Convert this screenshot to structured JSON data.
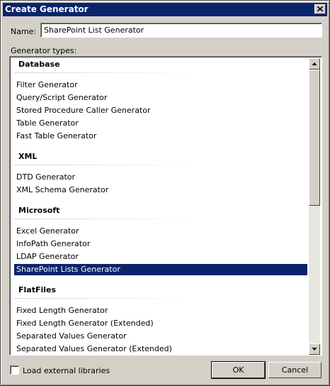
{
  "window": {
    "title": "Create Generator"
  },
  "name": {
    "label": "Name:",
    "value": "SharePoint List Generator"
  },
  "types_label": "Generator types:",
  "groups": [
    {
      "title": "Database",
      "items": [
        "Filter Generator",
        "Query/Script Generator",
        "Stored Procedure Caller Generator",
        "Table Generator",
        "Fast Table Generator"
      ]
    },
    {
      "title": "XML",
      "items": [
        "DTD Generator",
        "XML Schema Generator"
      ]
    },
    {
      "title": "Microsoft",
      "items": [
        "Excel Generator",
        "InfoPath Generator",
        "LDAP Generator",
        "SharePoint Lists Generator"
      ]
    },
    {
      "title": "FlatFiles",
      "items": [
        "Fixed Length Generator",
        "Fixed Length Generator (Extended)",
        "Separated Values Generator",
        "Separated Values Generator (Extended)"
      ]
    }
  ],
  "selected_item": "SharePoint Lists Generator",
  "load_external": {
    "label": "Load external libraries",
    "checked": false
  },
  "buttons": {
    "ok": "OK",
    "cancel": "Cancel"
  },
  "colors": {
    "titlebar": "#0a246a",
    "selection": "#0a246a",
    "face": "#d4d0c8"
  }
}
